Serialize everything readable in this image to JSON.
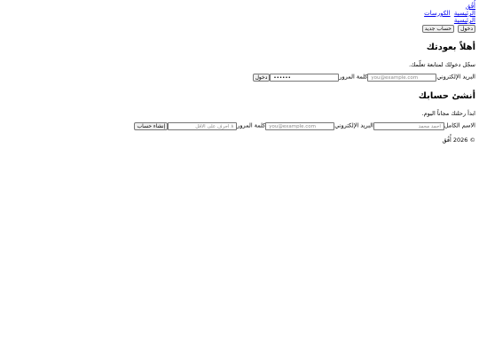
{
  "header": {
    "logo": "أُفُق",
    "nav_main": [
      {
        "label": "الرئيسية"
      },
      {
        "label": "الكورسات"
      }
    ],
    "nav_secondary": "الرئيسية",
    "login_button": "دخول",
    "register_button": "حساب جديد"
  },
  "login": {
    "title": "أهلاً بعودتك",
    "subtitle": "سجّل دخولك لمتابعة تعلّمك.",
    "email_label": "البريد الإلكتروني",
    "email_placeholder": "you@example.com",
    "password_label": "كلمة المرور",
    "password_value": "••••••",
    "submit": "دخول"
  },
  "register": {
    "title": "أنشئ حسابك",
    "subtitle": "ابدأ رحلتك مجاناً اليوم.",
    "name_label": "الاسم الكامل",
    "name_placeholder": "أحمد محمد",
    "email_label": "البريد الإلكتروني",
    "email_placeholder": "you@example.com",
    "password_label": "كلمة المرور",
    "password_placeholder": "٨ أحرف على الأقل",
    "submit": "إنشاء حساب"
  },
  "footer": {
    "copyright": "© 2026 أُفُق"
  }
}
